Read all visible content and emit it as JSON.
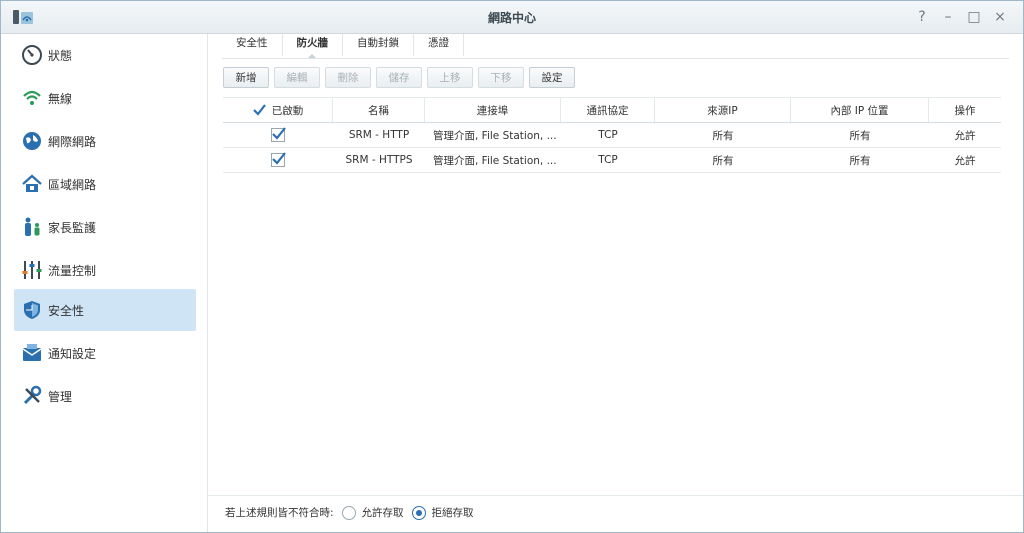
{
  "window": {
    "title": "網路中心",
    "controls": [
      "?",
      "–",
      "□",
      "×"
    ]
  },
  "sidebar": {
    "items": [
      {
        "label": "狀態",
        "icon": "gauge-icon"
      },
      {
        "label": "無線",
        "icon": "wifi-icon"
      },
      {
        "label": "網際網路",
        "icon": "globe-icon"
      },
      {
        "label": "區域網路",
        "icon": "home-network-icon"
      },
      {
        "label": "家長監護",
        "icon": "family-icon"
      },
      {
        "label": "流量控制",
        "icon": "sliders-icon"
      },
      {
        "label": "安全性",
        "icon": "shield-icon"
      },
      {
        "label": "通知設定",
        "icon": "mail-icon"
      },
      {
        "label": "管理",
        "icon": "tools-icon"
      }
    ],
    "active": "安全性"
  },
  "tabs": [
    "安全性",
    "防火牆",
    "自動封鎖",
    "憑證"
  ],
  "active_tab": "防火牆",
  "toolbar": {
    "add": "新增",
    "edit": "編輯",
    "delete": "刪除",
    "save": "儲存",
    "up": "上移",
    "down": "下移",
    "settings": "設定"
  },
  "grid": {
    "headers": [
      "已啟動",
      "名稱",
      "連接埠",
      "通訊協定",
      "來源IP",
      "內部 IP 位置",
      "操作"
    ],
    "rows": [
      {
        "enabled": true,
        "name": "SRM - HTTP",
        "port": "管理介面, File Station, ...",
        "protocol": "TCP",
        "source": "所有",
        "internal": "所有",
        "action": "允許"
      },
      {
        "enabled": true,
        "name": "SRM - HTTPS",
        "port": "管理介面, File Station, ...",
        "protocol": "TCP",
        "source": "所有",
        "internal": "所有",
        "action": "允許"
      }
    ]
  },
  "footer": {
    "label": "若上述規則皆不符合時:",
    "allow": "允許存取",
    "deny": "拒絕存取",
    "selected": "deny"
  },
  "colors": {
    "accent": "#2a6fb0",
    "active_nav": "#cfe4f5",
    "desktop": "#2a93b6"
  }
}
